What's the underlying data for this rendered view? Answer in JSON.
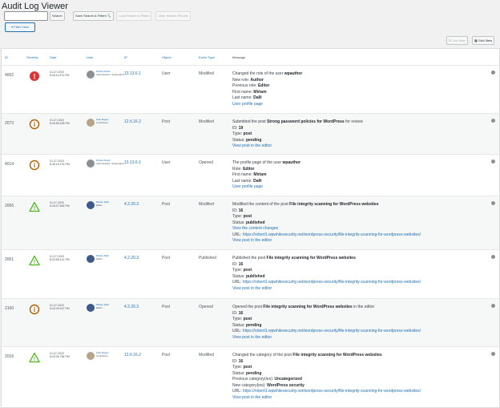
{
  "page": {
    "title": "Audit Log Viewer"
  },
  "toolbar": {
    "search_value": "",
    "search_label": "Search",
    "save_label": "Save Search & Filters",
    "load_label": "Load Search & Filters",
    "clear_label": "Clear Search Results",
    "filter_view_label": "Filter View",
    "list_view_label": "List View",
    "grid_view_label": "Grid View"
  },
  "columns": {
    "id": "ID",
    "severity": "Severity",
    "date": "Date",
    "user": "User",
    "ip": "IP",
    "object": "Object",
    "event_type": "Event Type",
    "message": "Message"
  },
  "colors": {
    "critical": "#d63638",
    "medium": "#b26200",
    "low": "#4ab516",
    "link": "#2271b1"
  },
  "rows": [
    {
      "id": "4002",
      "severity": "critical",
      "date": "01-07-2020",
      "time": "8:46:11.674 PM",
      "user_name": "Robert Abela",
      "user_role": "Administrator, Superadmin",
      "ip": "13.13.6.1",
      "object": "User",
      "event_type": "Modified",
      "message": [
        {
          "t": "Changed the role of the user ",
          "b": "wpauthor"
        },
        {
          "t": "New role: ",
          "b": "Author"
        },
        {
          "t": "Previous role: ",
          "b": "Editor"
        },
        {
          "t": "First name: ",
          "b": "Miriam"
        },
        {
          "t": "Last name: ",
          "b": "Dalli"
        },
        {
          "link": "User profile page"
        }
      ]
    },
    {
      "id": "2073",
      "severity": "medium",
      "date": "01-07-2020",
      "time": "8:45:55.428 PM",
      "user_name": "Kate Ragim",
      "user_role": "Contributor",
      "ip": "12.6.16.2",
      "object": "Post",
      "event_type": "Modified",
      "message": [
        {
          "t": "Submitted the post ",
          "b": "Strong password policies for WordPress",
          "t2": " for review"
        },
        {
          "t": "ID: ",
          "b": "19"
        },
        {
          "t": "Type: ",
          "b": "post"
        },
        {
          "t": "Status: ",
          "b": "pending"
        },
        {
          "link": "View post in the editor"
        }
      ]
    },
    {
      "id": "4014",
      "severity": "medium",
      "date": "01-07-2020",
      "time": "8:45:16.276 PM",
      "user_name": "Robert Abela",
      "user_role": "Administrator, Superadmin",
      "ip": "13.13.6.1",
      "object": "User",
      "event_type": "Opened",
      "message": [
        {
          "t": "The profile page of the user ",
          "b": "wpauthor"
        },
        {
          "t": "Role: ",
          "b": "Editor"
        },
        {
          "t": "First name: ",
          "b": "Miriam"
        },
        {
          "t": "Last name: ",
          "b": "Dalli"
        },
        {
          "link": "User profile page"
        }
      ]
    },
    {
      "id": "2065",
      "severity": "low",
      "date": "01-07-2020",
      "time": "8:44:07.846 PM",
      "user_name": "Miriam Dalli",
      "user_role": "Editor",
      "ip": "4.2.20.3",
      "object": "Post",
      "event_type": "Modified",
      "message": [
        {
          "t": "Modified the content of the post ",
          "b": "File integrity scanning for WordPress websites"
        },
        {
          "t": "ID: ",
          "b": "16"
        },
        {
          "t": "Type: ",
          "b": "post"
        },
        {
          "t": "Status: ",
          "b": "published"
        },
        {
          "link": "View the content changes"
        },
        {
          "t": "URL: ",
          "link": "https://robert1.wpwhitesecurity.net/wordpress-security/file-integrity-scanning-for-wordpress-websites/"
        },
        {
          "link": "View post in the editor"
        }
      ]
    },
    {
      "id": "2001",
      "severity": "low",
      "date": "01-07-2020",
      "time": "8:43:58.141 PM",
      "user_name": "Miriam Dalli",
      "user_role": "Editor",
      "ip": "4.2.20.3",
      "object": "Post",
      "event_type": "Published",
      "message": [
        {
          "t": "Published the post ",
          "b": "File integrity scanning for WordPress websites"
        },
        {
          "t": "ID: ",
          "b": "16"
        },
        {
          "t": "Type: ",
          "b": "post"
        },
        {
          "t": "Status: ",
          "b": "published"
        },
        {
          "t": "URL: ",
          "link": "https://robert1.wpwhitesecurity.net/wordpress-security/file-integrity-scanning-for-wordpress-websites/"
        },
        {
          "link": "View post in the editor"
        }
      ]
    },
    {
      "id": "2100",
      "severity": "medium",
      "date": "01-07-2020",
      "time": "8:43:49.447 PM",
      "user_name": "Miriam Dalli",
      "user_role": "Editor",
      "ip": "4.2.20.3",
      "object": "Post",
      "event_type": "Opened",
      "message": [
        {
          "t": "Opened the post ",
          "b": "File integrity scanning for WordPress websites",
          "t2": " in the editor"
        },
        {
          "t": "ID: ",
          "b": "16"
        },
        {
          "t": "Type: ",
          "b": "post"
        },
        {
          "t": "Status: ",
          "b": "pending"
        },
        {
          "t": "URL: ",
          "link": "https://robert1.wpwhitesecurity.net/wordpress-security/file-integrity-scanning-for-wordpress-websites/"
        },
        {
          "link": "View post in the editor"
        }
      ]
    },
    {
      "id": "2016",
      "severity": "low",
      "date": "01-07-2020",
      "time": "8:43:39.756 PM",
      "user_name": "Kate Ragim",
      "user_role": "Contributor",
      "ip": "12.6.16.2",
      "object": "Post",
      "event_type": "Modified",
      "message": [
        {
          "t": "Changed the category of the post ",
          "b": "File integrity scanning for WordPress websites"
        },
        {
          "t": "ID: ",
          "b": "16"
        },
        {
          "t": "Type: ",
          "b": "post"
        },
        {
          "t": "Status: ",
          "b": "pending"
        },
        {
          "t": "Previous category(ies): ",
          "b": "Uncategorized"
        },
        {
          "t": "New category(ies): ",
          "b": "WordPress security"
        },
        {
          "t": "URL: ",
          "link": "https://robert1.wpwhitesecurity.net/wordpress-security/file-integrity-scanning-for-wordpress-websites/"
        },
        {
          "link": "View post in the editor"
        }
      ]
    }
  ]
}
